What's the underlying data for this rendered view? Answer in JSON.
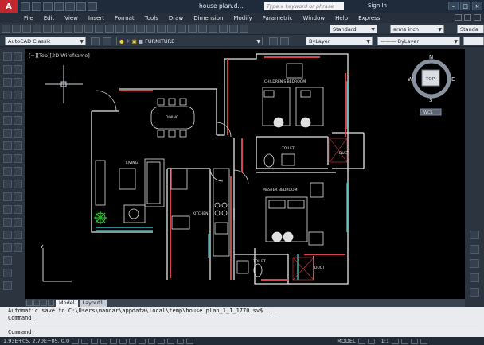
{
  "titlebar": {
    "app_logo": "A",
    "document_title": "house plan.d...",
    "search_placeholder": "Type a keyword or phrase",
    "signin_label": "Sign In"
  },
  "menu": [
    "File",
    "Edit",
    "View",
    "Insert",
    "Format",
    "Tools",
    "Draw",
    "Dimension",
    "Modify",
    "Parametric",
    "Window",
    "Help",
    "Express"
  ],
  "toolbar": {
    "text_style": "Standard",
    "dim_style": "arms inch",
    "table_style": "Standa",
    "workspace": "AutoCAD Classic",
    "layer": "FURNITURE",
    "color": "ByLayer",
    "linetype": "ByLayer"
  },
  "viewport": {
    "label": "[−][Top][2D Wireframe]",
    "viewcube_top": "TOP",
    "compass": {
      "n": "N",
      "s": "S",
      "e": "E",
      "w": "W"
    },
    "wcs": "WCS"
  },
  "plan_labels": {
    "children_bedroom": "CHILDREN'S BEDROOM",
    "dining": "DINING",
    "living": "LIVING",
    "kitchen": "KITCHEN",
    "toilet_1": "TOILET",
    "toilet_2": "TOILET",
    "master_bedroom": "MASTER BEDROOM",
    "duct_1": "DUCT",
    "duct_2": "DUCT"
  },
  "tabs": [
    "Model",
    "Layout1"
  ],
  "command": {
    "history_1": "Automatic save to C:\\Users\\mandar\\appdata\\local\\temp\\house plan_1_1_1770.sv$ ...",
    "history_2": "Command:",
    "prompt": "Command:"
  },
  "statusbar": {
    "coords": "1.93E+05, 2.70E+05, 0.0",
    "model_label": "MODEL",
    "scale": "1:1"
  }
}
